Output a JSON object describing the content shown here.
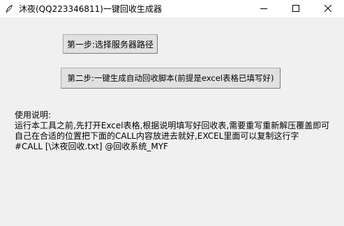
{
  "window": {
    "title": "沐夜(QQ223346811)一键回收生成器",
    "icon": "feather-icon",
    "controls": {
      "minimize": "minimize-icon",
      "maximize": "maximize-icon",
      "close": "close-icon"
    }
  },
  "buttons": {
    "step1_label": "第一步:选择服务器路径",
    "step2_label": "第二步:一键生成自动回收脚本(前提是excel表格已填写好)"
  },
  "instructions": {
    "heading": "使用说明:",
    "lines": [
      "运行本工具之前,先打开Excel表格,根据说明填写好回收表,需要重写重新解压覆盖即可",
      "自己在合适的位置把下面的CALL内容放进去就好,EXCEL里面可以复制这行字",
      "#CALL [\\沐夜回收.txt] @回收系统_MYF"
    ]
  }
}
